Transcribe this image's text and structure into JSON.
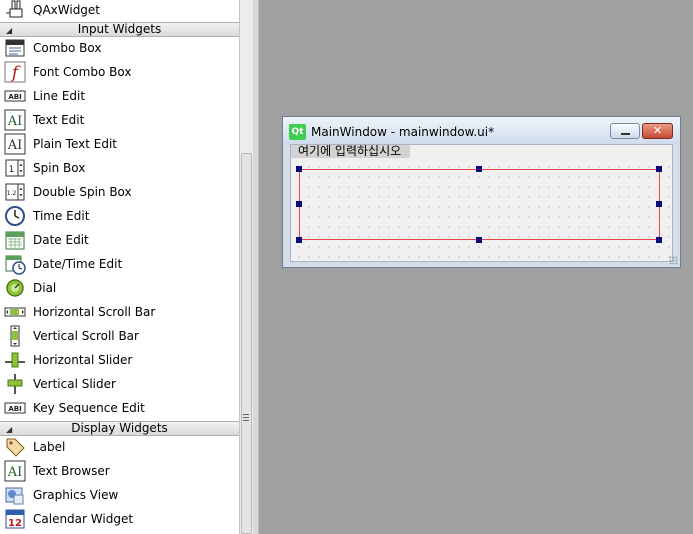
{
  "widget_box": {
    "top_partial": {
      "label": "QAxWidget",
      "icon": "qaxwidget-icon"
    },
    "categories": [
      {
        "name": "Input Widgets",
        "items": [
          {
            "label": "Combo Box",
            "icon": "combo-box-icon"
          },
          {
            "label": "Font Combo Box",
            "icon": "font-combo-box-icon"
          },
          {
            "label": "Line Edit",
            "icon": "line-edit-icon"
          },
          {
            "label": "Text Edit",
            "icon": "text-edit-icon"
          },
          {
            "label": "Plain Text Edit",
            "icon": "plain-text-edit-icon"
          },
          {
            "label": "Spin Box",
            "icon": "spin-box-icon"
          },
          {
            "label": "Double Spin Box",
            "icon": "double-spin-box-icon"
          },
          {
            "label": "Time Edit",
            "icon": "time-edit-icon"
          },
          {
            "label": "Date Edit",
            "icon": "date-edit-icon"
          },
          {
            "label": "Date/Time Edit",
            "icon": "date-time-edit-icon"
          },
          {
            "label": "Dial",
            "icon": "dial-icon"
          },
          {
            "label": "Horizontal Scroll Bar",
            "icon": "horizontal-scroll-bar-icon"
          },
          {
            "label": "Vertical Scroll Bar",
            "icon": "vertical-scroll-bar-icon"
          },
          {
            "label": "Horizontal Slider",
            "icon": "horizontal-slider-icon"
          },
          {
            "label": "Vertical Slider",
            "icon": "vertical-slider-icon"
          },
          {
            "label": "Key Sequence Edit",
            "icon": "key-sequence-edit-icon"
          }
        ]
      },
      {
        "name": "Display Widgets",
        "items": [
          {
            "label": "Label",
            "icon": "label-icon"
          },
          {
            "label": "Text Browser",
            "icon": "text-browser-icon"
          },
          {
            "label": "Graphics View",
            "icon": "graphics-view-icon"
          },
          {
            "label": "Calendar Widget",
            "icon": "calendar-widget-icon"
          }
        ]
      }
    ]
  },
  "form_window": {
    "logo_text": "Qt",
    "title": "MainWindow - mainwindow.ui*",
    "menu_placeholder": "여기에 입력하십시오",
    "close_glyph": "✕"
  },
  "icon_text": {
    "line_edit": "ABI",
    "text_edit": "AI",
    "spin_box": "1",
    "double_spin_box": "1.2",
    "calendar": "12",
    "font_f": "f"
  },
  "colors": {
    "canvas": "#a0a0a0",
    "selection": "#e8474f",
    "handle": "#0a0a78",
    "qt_green": "#41cd52"
  }
}
